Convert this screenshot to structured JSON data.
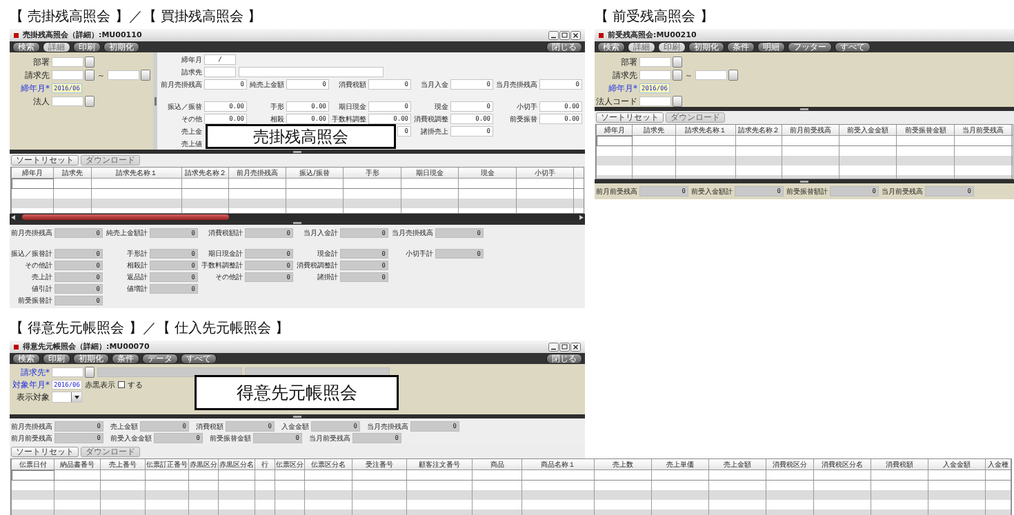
{
  "panels": [
    {
      "caption": "【 売掛残高照会 】／【 買掛残高照会 】",
      "callout": "売掛残高照会",
      "window": {
        "title": "売掛残高照会（詳細）:MU00110",
        "window_controls": true,
        "toolbar": [
          {
            "label": "検索",
            "disabled": false
          },
          {
            "label": "詳細",
            "disabled": true
          },
          {
            "label": "印刷",
            "disabled": false
          },
          {
            "label": "初期化",
            "disabled": false
          }
        ],
        "close_button": "閉じる",
        "conditions": [
          {
            "label": "部署",
            "required": false,
            "items": [
              {
                "kind": "lookup"
              }
            ]
          },
          {
            "label": "請求先",
            "required": false,
            "items": [
              {
                "kind": "lookup"
              },
              {
                "kind": "text",
                "text": "～"
              },
              {
                "kind": "lookup"
              }
            ]
          },
          {
            "label": "締年月*",
            "required": true,
            "items": [
              {
                "kind": "input",
                "value": "2016/06",
                "focused": true
              }
            ]
          },
          {
            "label": "法人",
            "required": false,
            "items": [
              {
                "kind": "lookup"
              }
            ]
          }
        ],
        "detail": [
          {
            "rows": [
              {
                "cells": [
                  {
                    "kind": "period",
                    "label": "締年月",
                    "value": "/"
                  }
                ]
              },
              {
                "cells": [
                  {
                    "kind": "code_name",
                    "label": "請求先"
                  }
                ]
              },
              {
                "cells": [
                  {
                    "kind": "amount",
                    "label": "前月売掛残高",
                    "value": "0"
                  },
                  {
                    "kind": "amount",
                    "label": "純売上金額",
                    "value": "0"
                  },
                  {
                    "kind": "amount",
                    "label": "消費税額",
                    "value": "0"
                  },
                  {
                    "kind": "amount",
                    "label": "当月入金",
                    "value": "0"
                  },
                  {
                    "kind": "amount",
                    "label": "当月売掛残高",
                    "value": "0"
                  }
                ]
              }
            ]
          },
          {
            "rows": [
              {
                "cells": [
                  {
                    "kind": "amount",
                    "label": "振込／振替",
                    "value": "0.00"
                  },
                  {
                    "kind": "amount",
                    "label": "手形",
                    "value": "0.00"
                  },
                  {
                    "kind": "amount",
                    "label": "期日現金",
                    "value": "0"
                  },
                  {
                    "kind": "amount",
                    "label": "現金",
                    "value": "0"
                  },
                  {
                    "kind": "amount",
                    "label": "小切手",
                    "value": "0.00"
                  }
                ]
              },
              {
                "cells": [
                  {
                    "kind": "amount",
                    "label": "その他",
                    "value": "0.00"
                  },
                  {
                    "kind": "amount",
                    "label": "相殺",
                    "value": "0.00"
                  },
                  {
                    "kind": "amount",
                    "label": "手数料調整",
                    "value": "0.00"
                  },
                  {
                    "kind": "amount",
                    "label": "消費税調整",
                    "value": "0.00"
                  },
                  {
                    "kind": "amount",
                    "label": "前受振替",
                    "value": "0.00"
                  }
                ]
              },
              {
                "cells": [
                  {
                    "kind": "label_only",
                    "label": "売上金"
                  },
                  {
                    "kind": "covered"
                  },
                  {
                    "kind": "value_only",
                    "value": "0"
                  },
                  {
                    "kind": "amount",
                    "label": "諸掛売上",
                    "value": "0"
                  }
                ]
              },
              {
                "cells": [
                  {
                    "kind": "label_only",
                    "label": "売上値"
                  }
                ]
              }
            ]
          }
        ],
        "table_buttons": [
          {
            "label": "ソートリセット",
            "disabled": false
          },
          {
            "label": "ダウンロード",
            "disabled": true
          }
        ],
        "table": {
          "columns": [
            "締年月",
            "請求先",
            "請求先名称１",
            "請求先名称２",
            "前月売掛残高",
            "振込/振替",
            "手形",
            "期日現金",
            "現金",
            "小切手"
          ]
        },
        "footer": [
          {
            "rows": [
              {
                "cells": [
                  {
                    "label": "前月売掛残高",
                    "value": "0"
                  },
                  {
                    "label": "純売上金額計",
                    "value": "0"
                  },
                  {
                    "label": "消費税額計",
                    "value": "0"
                  },
                  {
                    "label": "当月入金計",
                    "value": "0"
                  },
                  {
                    "label": "当月売掛残高",
                    "value": "0"
                  }
                ]
              }
            ]
          },
          {
            "rows": [
              {
                "cells": [
                  {
                    "label": "振込／振替計",
                    "value": "0"
                  },
                  {
                    "label": "手形計",
                    "value": "0"
                  },
                  {
                    "label": "期日現金計",
                    "value": "0"
                  },
                  {
                    "label": "現金計",
                    "value": "0"
                  },
                  {
                    "label": "小切手計",
                    "value": "0"
                  }
                ]
              },
              {
                "cells": [
                  {
                    "label": "その他計",
                    "value": "0"
                  },
                  {
                    "label": "相殺計",
                    "value": "0"
                  },
                  {
                    "label": "手数料調整計",
                    "value": "0"
                  },
                  {
                    "label": "消費税調整計",
                    "value": "0"
                  }
                ]
              },
              {
                "cells": [
                  {
                    "label": "売上計",
                    "value": "0"
                  },
                  {
                    "label": "返品計",
                    "value": "0"
                  },
                  {
                    "label": "その他計",
                    "value": "0"
                  },
                  {
                    "label": "諸掛計",
                    "value": "0"
                  }
                ]
              },
              {
                "cells": [
                  {
                    "label": "値引計",
                    "value": "0"
                  },
                  {
                    "label": "値増計",
                    "value": "0"
                  }
                ]
              },
              {
                "cells": [
                  {
                    "label": "前受振替計",
                    "value": "0"
                  }
                ]
              }
            ]
          }
        ]
      }
    },
    {
      "caption": "【 前受残高照会 】",
      "window": {
        "title": "前受残高照会:MU00210",
        "window_controls": false,
        "toolbar": [
          {
            "label": "検索",
            "disabled": false
          },
          {
            "label": "詳細",
            "disabled": true
          },
          {
            "label": "印刷",
            "disabled": true
          },
          {
            "label": "初期化",
            "disabled": false
          },
          {
            "label": "条件",
            "disabled": false
          },
          {
            "label": "明細",
            "disabled": false
          },
          {
            "label": "フッター",
            "disabled": false
          },
          {
            "label": "すべて",
            "disabled": false
          }
        ],
        "conditions": [
          {
            "label": "部署",
            "required": false,
            "items": [
              {
                "kind": "lookup"
              }
            ]
          },
          {
            "label": "請求先",
            "required": false,
            "items": [
              {
                "kind": "lookup"
              },
              {
                "kind": "text",
                "text": "～"
              },
              {
                "kind": "lookup"
              }
            ]
          },
          {
            "label": "締年月*",
            "required": true,
            "items": [
              {
                "kind": "input",
                "value": "2016/06",
                "focused": true
              }
            ]
          },
          {
            "label": "法人コード",
            "required": false,
            "items": [
              {
                "kind": "lookup"
              }
            ]
          }
        ],
        "table_buttons": [
          {
            "label": "ソートリセット",
            "disabled": false
          },
          {
            "label": "ダウンロード",
            "disabled": true
          }
        ],
        "table": {
          "columns": [
            "締年月",
            "請求先",
            "請求先名称１",
            "請求先名称２",
            "前月前受残高",
            "前受入金金額",
            "前受振替金額",
            "当月前受残高"
          ]
        },
        "footer": [
          {
            "rows": [
              {
                "cells": [
                  {
                    "label": "前月前受残高",
                    "value": "0"
                  },
                  {
                    "label": "前受入金額計",
                    "value": "0"
                  },
                  {
                    "label": "前受振替額計",
                    "value": "0"
                  },
                  {
                    "label": "当月前受残高",
                    "value": "0"
                  }
                ]
              }
            ]
          }
        ]
      }
    },
    {
      "caption": "【 得意先元帳照会 】／【 仕入先元帳照会 】",
      "callout": "得意先元帳照会",
      "window": {
        "title": "得意先元帳照会（詳細）:MU00070",
        "window_controls": true,
        "toolbar": [
          {
            "label": "検索",
            "disabled": false
          },
          {
            "label": "印刷",
            "disabled": false
          },
          {
            "label": "初期化",
            "disabled": false
          },
          {
            "label": "条件",
            "disabled": false
          },
          {
            "label": "データ",
            "disabled": false
          },
          {
            "label": "すべて",
            "disabled": false
          }
        ],
        "close_button": "閉じる",
        "conditions": [
          {
            "label": "請求先*",
            "required": true,
            "items": [
              {
                "kind": "lookup"
              },
              {
                "kind": "readonly"
              },
              {
                "kind": "readonly"
              }
            ]
          },
          {
            "label": "対象年月*",
            "required": true,
            "items": [
              {
                "kind": "input",
                "value": "2016/06",
                "focused": false
              },
              {
                "kind": "text",
                "text": "赤黒表示"
              },
              {
                "kind": "checkbox",
                "checked": false,
                "label": "する"
              }
            ]
          },
          {
            "label": "表示対象",
            "required": false,
            "items": [
              {
                "kind": "select"
              }
            ]
          }
        ],
        "summary": [
          {
            "cells": [
              {
                "label": "前月売掛残高",
                "value": "0"
              },
              {
                "label": "売上金額",
                "value": "0"
              },
              {
                "label": "消費税額",
                "value": "0"
              },
              {
                "label": "入金金額",
                "value": "0"
              },
              {
                "label": "当月売掛残高",
                "value": "0"
              }
            ]
          },
          {
            "cells": [
              {
                "label": "前月前受残高",
                "value": "0"
              },
              {
                "label": "前受入金金額",
                "value": "0"
              },
              {
                "label": "前受振替金額",
                "value": "0"
              },
              {
                "label": "当月前受残高",
                "value": "0"
              }
            ]
          }
        ],
        "table_buttons": [
          {
            "label": "ソートリセット",
            "disabled": false
          },
          {
            "label": "ダウンロード",
            "disabled": true
          }
        ],
        "table": {
          "columns": [
            "伝票日付",
            "納品書番号",
            "売上番号",
            "伝票訂正番号",
            "赤黒区分",
            "赤黒区分名",
            "行",
            "伝票区分",
            "伝票区分名",
            "受注番号",
            "顧客注文番号",
            "商品",
            "商品名称１",
            "売上数",
            "売上単価",
            "売上金額",
            "消費税区分",
            "消費税区分名",
            "消費税額",
            "入金金額",
            "入金種"
          ]
        }
      }
    }
  ]
}
